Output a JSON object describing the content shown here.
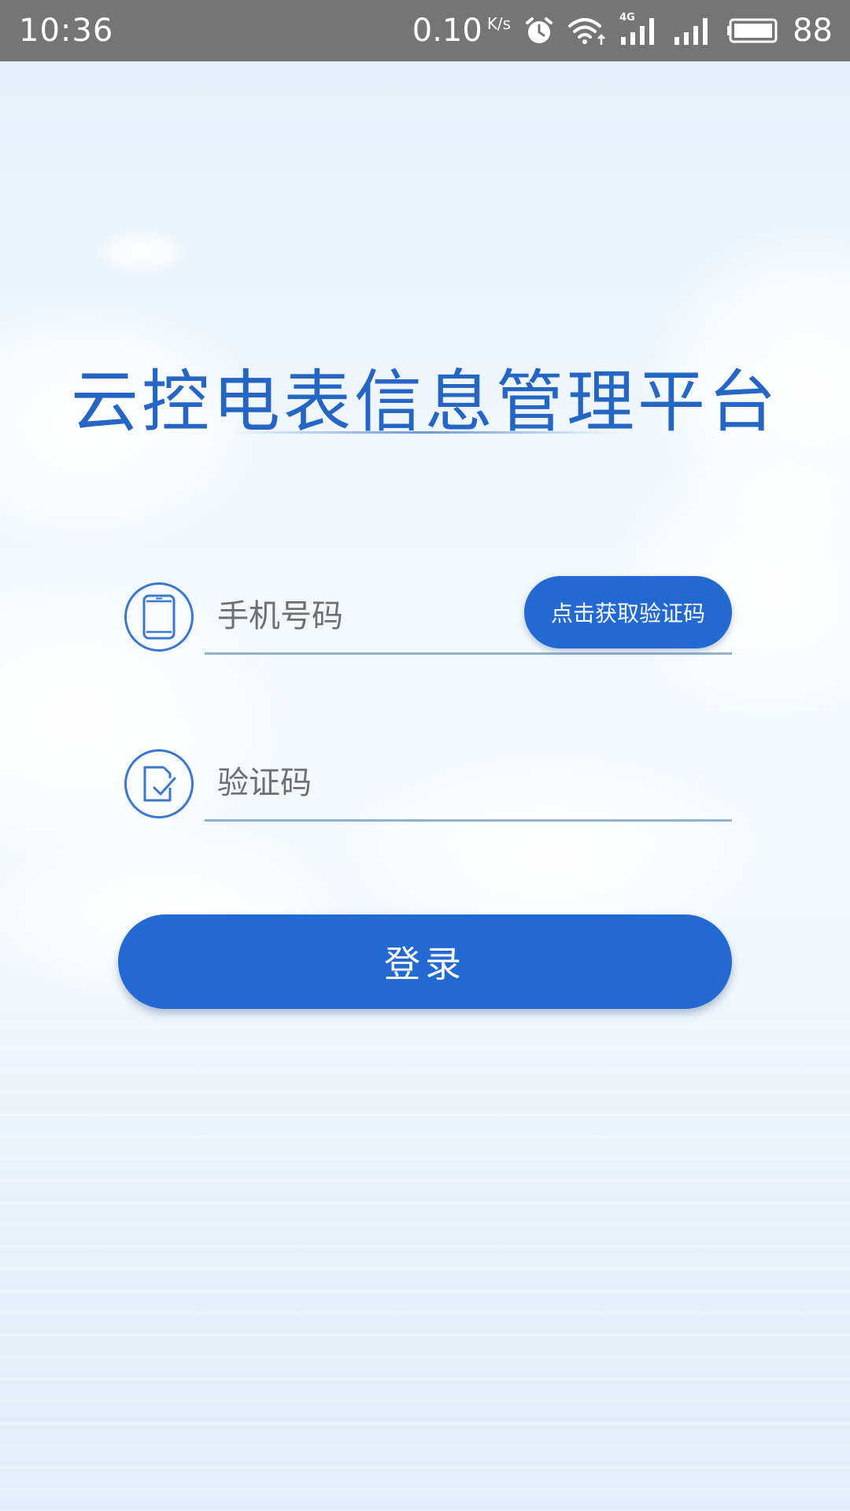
{
  "status_bar": {
    "time": "10:36",
    "net_speed": "0.10",
    "net_unit": "K/s",
    "network_type": "4G",
    "battery_level": "88"
  },
  "app": {
    "title": "云控电表信息管理平台"
  },
  "form": {
    "phone_placeholder": "手机号码",
    "phone_value": "",
    "get_code_label": "点击获取验证码",
    "code_placeholder": "验证码",
    "code_value": "",
    "login_label": "登录"
  },
  "icons": {
    "phone": "phone-icon",
    "code": "verify-code-icon",
    "alarm": "alarm-icon",
    "wifi": "wifi-icon",
    "signal": "signal-icon",
    "battery": "battery-icon"
  },
  "colors": {
    "primary": "#2269d1",
    "title": "#2566c5",
    "status_bar": "#757575",
    "underline": "#8fb3cc"
  }
}
